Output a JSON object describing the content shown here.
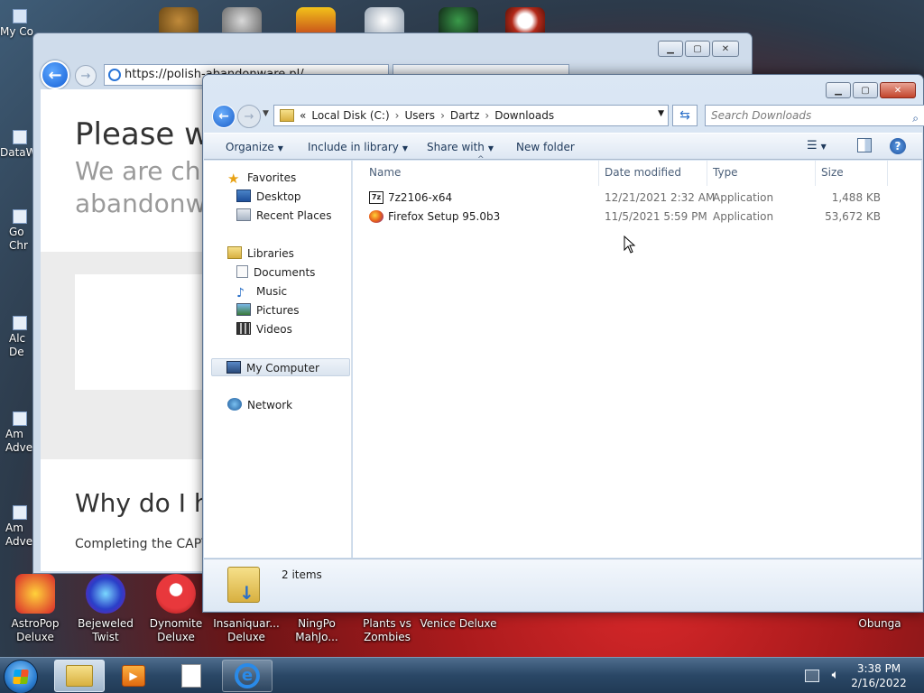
{
  "desktop": {
    "left_icons": [
      {
        "label": "My Co",
        "name": "desktop-icon-my-computer"
      },
      {
        "label": "DataW",
        "name": "desktop-icon-dataw"
      },
      {
        "label": "Go Chr",
        "name": "desktop-icon-google-chrome"
      },
      {
        "label": "Alc De",
        "name": "desktop-icon-alc-deluxe"
      },
      {
        "label": "Am Adve",
        "name": "desktop-icon-am-adventure-1"
      },
      {
        "label": "Am Adve",
        "name": "desktop-icon-am-adventure-2"
      }
    ],
    "bottom_icons": [
      {
        "label1": "AstroPop",
        "label2": "Deluxe",
        "color": "#d8262a",
        "name": "desktop-icon-astropop-deluxe"
      },
      {
        "label1": "Bejeweled",
        "label2": "Twist",
        "color": "#5b3bc8",
        "name": "desktop-icon-bejeweled-twist"
      },
      {
        "label1": "Dynomite",
        "label2": "Deluxe",
        "color": "#e8383c",
        "name": "desktop-icon-dynomite-deluxe"
      },
      {
        "label1": "Insaniquar...",
        "label2": "Deluxe",
        "color": "#2c6a9a",
        "name": "desktop-icon-insaniquarium-deluxe"
      },
      {
        "label1": "NingPo",
        "label2": "MahJo...",
        "color": "#8a2a22",
        "name": "desktop-icon-ningpo-mahjong"
      },
      {
        "label1": "Plants vs",
        "label2": "Zombies",
        "color": "#5e8a2e",
        "name": "desktop-icon-plants-vs-zombies"
      },
      {
        "label1": "Venice Deluxe",
        "label2": "",
        "color": "#7a2a2a",
        "name": "desktop-icon-venice-deluxe"
      },
      {
        "label1": "Obunga",
        "label2": "",
        "color": "#8a1b1d",
        "name": "desktop-icon-obunga"
      }
    ]
  },
  "browser": {
    "url": "https://polish-abandonware.pl/",
    "tab_label": "",
    "heading": "Please wa",
    "subheading_line1": "We are che",
    "subheading_line2": "abandonwa",
    "section_heading": "Why do I h",
    "section_text": "Completing the CAPT"
  },
  "explorer": {
    "breadcrumb": [
      "Local Disk (C:)",
      "Users",
      "Dartz",
      "Downloads"
    ],
    "breadcrumb_prefix": "«",
    "search_placeholder": "Search Downloads",
    "commands": {
      "organize": "Organize",
      "include_in_library": "Include in library",
      "share_with": "Share with",
      "new_folder": "New folder"
    },
    "nav": {
      "favorites": "Favorites",
      "desktop": "Desktop",
      "recent_places": "Recent Places",
      "libraries": "Libraries",
      "documents": "Documents",
      "music": "Music",
      "pictures": "Pictures",
      "videos": "Videos",
      "my_computer": "My Computer",
      "network": "Network"
    },
    "columns": {
      "name": "Name",
      "date_modified": "Date modified",
      "type": "Type",
      "size": "Size"
    },
    "files": [
      {
        "name": "7z2106-x64",
        "date": "12/21/2021 2:32 AM",
        "type": "Application",
        "size": "1,488 KB",
        "icon": "7zip-icon"
      },
      {
        "name": "Firefox Setup 95.0b3",
        "date": "11/5/2021 5:59 PM",
        "type": "Application",
        "size": "53,672 KB",
        "icon": "firefox-icon"
      }
    ],
    "status": "2 items"
  },
  "taskbar": {
    "time": "3:38 PM",
    "date": "2/16/2022"
  }
}
